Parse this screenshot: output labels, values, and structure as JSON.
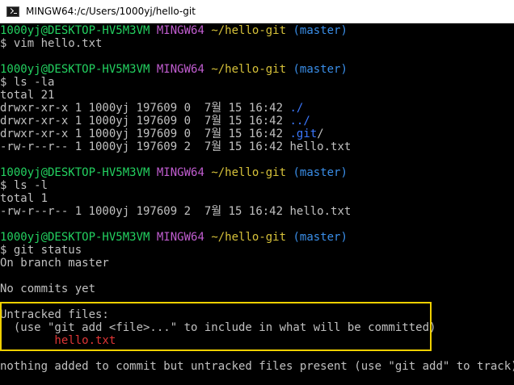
{
  "window": {
    "title": "MINGW64:/c/Users/1000yj/hello-git"
  },
  "prompt": {
    "user_host": "1000yj@DESKTOP-HV5M3VM",
    "env": "MINGW64",
    "path": "~/hello-git",
    "branch": "(master)"
  },
  "colors": {
    "user_host": "#23d160",
    "env": "#c15dd0",
    "path": "#d7c23a",
    "branch": "#3a8ee8",
    "text": "#c0c0c0",
    "untracked_file": "#e03535",
    "highlight_border": "#f0d000"
  },
  "session": {
    "cmd1": "$ vim hello.txt",
    "cmd2": "$ ls -la",
    "la_total": "total 21",
    "la_rows": [
      {
        "meta": "drwxr-xr-x 1 1000yj 197609 0  7월 15 16:42 ",
        "name": "./"
      },
      {
        "meta": "drwxr-xr-x 1 1000yj 197609 0  7월 15 16:42 ",
        "name": "../"
      },
      {
        "meta": "drwxr-xr-x 1 1000yj 197609 0  7월 15 16:42 ",
        "name": ".git",
        "suffix": "/"
      },
      {
        "meta": "-rw-r--r-- 1 1000yj 197609 2  7월 15 16:42 ",
        "name": "hello.txt"
      }
    ],
    "cmd3": "$ ls -l",
    "l_total": "total 1",
    "l_row": "-rw-r--r-- 1 1000yj 197609 2  7월 15 16:42 hello.txt",
    "cmd4": "$ git status",
    "on_branch": "On branch master",
    "no_commits": "No commits yet",
    "untracked_header": "Untracked files:",
    "untracked_hint": "  (use \"git add <file>...\" to include in what will be committed)",
    "untracked_file": "        hello.txt",
    "footer": "nothing added to commit but untracked files present (use \"git add\" to track)"
  }
}
